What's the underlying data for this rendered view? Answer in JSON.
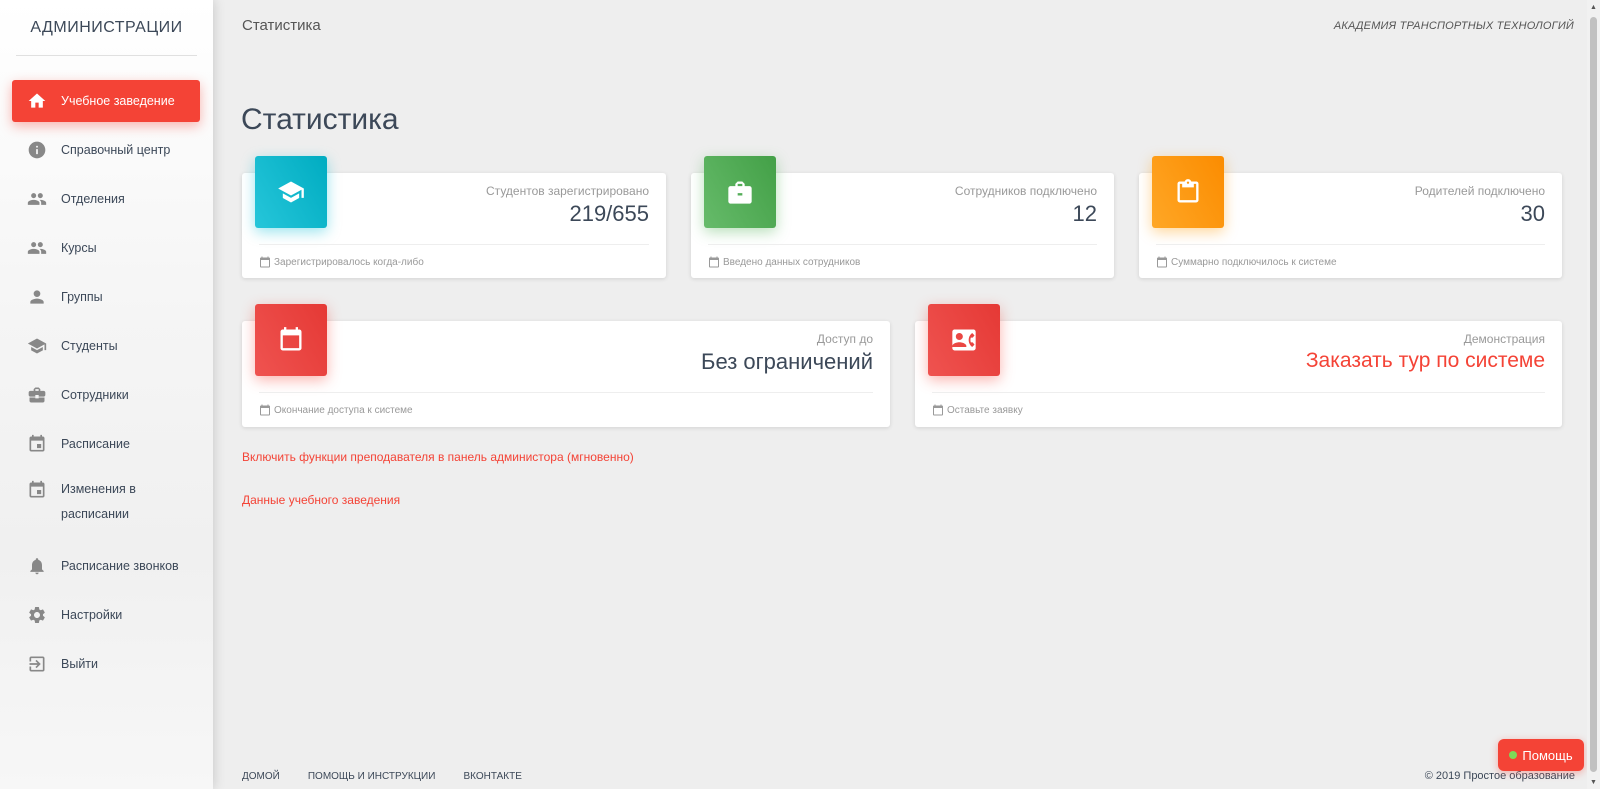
{
  "sidebar": {
    "logo": "АДМИНИСТРАЦИИ",
    "items": [
      {
        "label": "Учебное заведение",
        "icon": "home-icon"
      },
      {
        "label": "Справочный центр",
        "icon": "info-icon"
      },
      {
        "label": "Отделения",
        "icon": "people-icon"
      },
      {
        "label": "Курсы",
        "icon": "people-icon"
      },
      {
        "label": "Группы",
        "icon": "person-icon"
      },
      {
        "label": "Студенты",
        "icon": "school-icon"
      },
      {
        "label": "Сотрудники",
        "icon": "briefcase-icon"
      },
      {
        "label": "Расписание",
        "icon": "calendar-icon"
      },
      {
        "label": "Изменения в расписании",
        "icon": "calendar-icon"
      },
      {
        "label": "Расписание звонков",
        "icon": "bell-icon"
      },
      {
        "label": "Настройки",
        "icon": "gear-icon"
      },
      {
        "label": "Выйти",
        "icon": "exit-icon"
      }
    ]
  },
  "header": {
    "title": "Статистика",
    "organization": "АКАДЕМИЯ ТРАНСПОРТНЫХ ТЕХНОЛОГИЙ"
  },
  "main": {
    "title": "Статистика",
    "cards": [
      {
        "category": "Студентов зарегистрировано",
        "value": "219/655",
        "footer": "Зарегистрировалось когда-либо",
        "icon": "graduation-cap-icon",
        "color": "#00bcd4"
      },
      {
        "category": "Сотрудников подключено",
        "value": "12",
        "footer": "Введено данных сотрудников",
        "icon": "briefcase-icon",
        "color": "#4caf50"
      },
      {
        "category": "Родителей подключено",
        "value": "30",
        "footer": "Суммарно подключилось к системе",
        "icon": "clipboard-icon",
        "color": "#ff9800"
      },
      {
        "category": "Доступ до",
        "value": "Без ограничений",
        "footer": "Окончание доступа к системе",
        "icon": "calendar-icon",
        "color": "#f44336"
      },
      {
        "category": "Демонстрация",
        "value": "Заказать тур по системе",
        "footer": "Оставьте заявку",
        "icon": "contact-card-icon",
        "color": "#f44336"
      }
    ],
    "links": {
      "enable_teacher": "Включить функции преподавателя в панель администора (мгновенно)",
      "institution_data": "Данные учебного заведения"
    }
  },
  "footer": {
    "links": [
      "Домой",
      "Помощь и инструкции",
      "Вконтакте"
    ],
    "copyright": "© 2019 Простое образование"
  },
  "help_button": {
    "label": "Помощь"
  },
  "colors": {
    "accent": "#f44336",
    "cyan": "#00bcd4",
    "green": "#4caf50",
    "orange": "#ff9800"
  }
}
